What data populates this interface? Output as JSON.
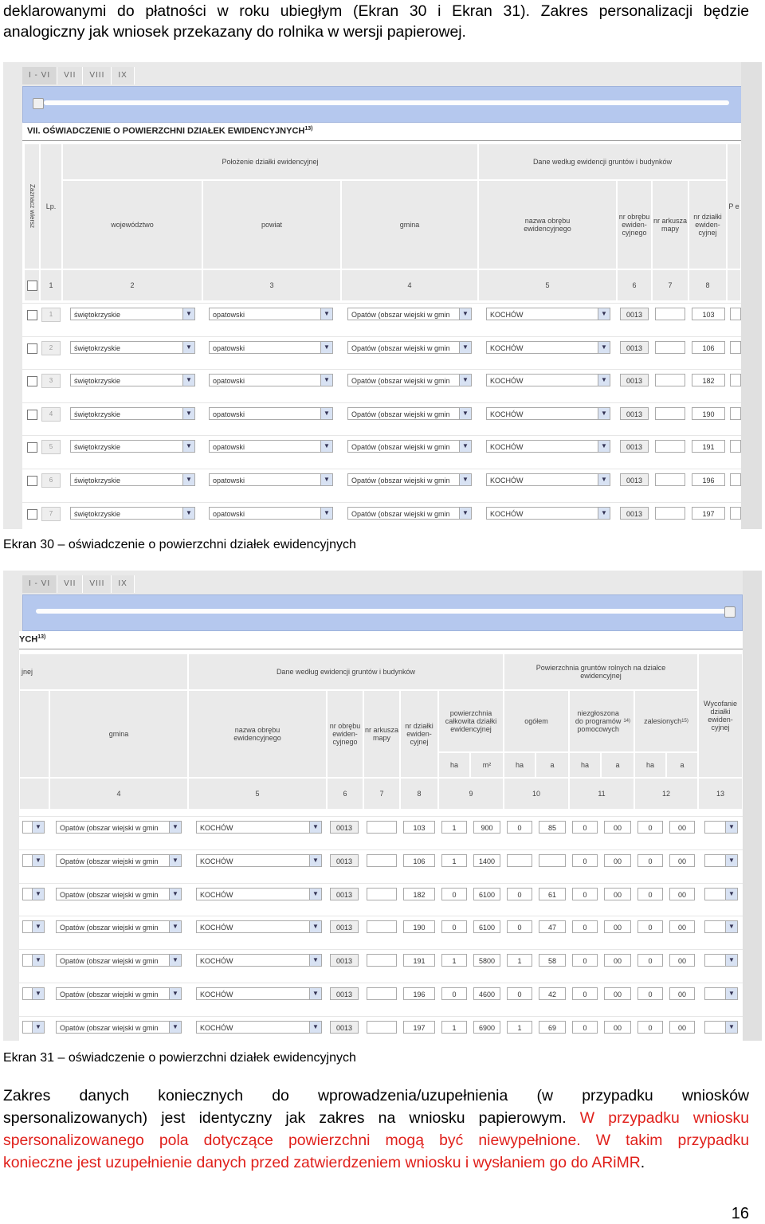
{
  "intro": {
    "line1": "deklarowanymi do płatności w roku ubiegłym (Ekran 30 i Ekran 31). Zakres personalizacji będzie",
    "line2": "analogiczny jak wniosek przekazany do rolnika w wersji papierowej."
  },
  "screen1": {
    "tabs": [
      "I - VI",
      "VII",
      "VIII",
      "IX"
    ],
    "section_title": "VII. OŚWIADCZENIE O POWIERZCHNI DZIAŁEK EWIDENCYJNYCH",
    "section_sup": "13)",
    "headers": {
      "zaznacz": "Zaznacz wiersz",
      "lp": "Lp.",
      "polozenie": "Położenie działki ewidencyjnej",
      "dane": "Dane według ewidencji gruntów i budynków",
      "wojewodztwo": "województwo",
      "powiat": "powiat",
      "gmina": "gmina",
      "obreb": "nazwa obrębu ewidencyjnego",
      "nr_obrebu": "nr obrębu ewiden-cyjnego",
      "nr_arkusza": "nr arkusza mapy",
      "nr_dzialki": "nr działki ewiden-cyjnej",
      "extra": "P e"
    },
    "colnums": [
      "1",
      "2",
      "3",
      "4",
      "5",
      "6",
      "7",
      "8"
    ]
  },
  "rows": [
    {
      "lp": "1",
      "woj": "świętokrzyskie",
      "pow": "opatowski",
      "gmina": "Opatów (obszar wiejski w gmin",
      "obreb": "KOCHÓW",
      "nr_obrebu": "0013",
      "nr_dzialki": "103",
      "ha": "1",
      "m2": "900",
      "og_ha": "0",
      "og_a": "85",
      "pp_ha": "0",
      "pp_a": "00",
      "z_ha": "0",
      "z_a": "00"
    },
    {
      "lp": "2",
      "woj": "świętokrzyskie",
      "pow": "opatowski",
      "gmina": "Opatów (obszar wiejski w gmin",
      "obreb": "KOCHÓW",
      "nr_obrebu": "0013",
      "nr_dzialki": "106",
      "ha": "1",
      "m2": "1400",
      "og_ha": "",
      "og_a": "",
      "pp_ha": "0",
      "pp_a": "00",
      "z_ha": "0",
      "z_a": "00"
    },
    {
      "lp": "3",
      "woj": "świętokrzyskie",
      "pow": "opatowski",
      "gmina": "Opatów (obszar wiejski w gmin",
      "obreb": "KOCHÓW",
      "nr_obrebu": "0013",
      "nr_dzialki": "182",
      "ha": "0",
      "m2": "6100",
      "og_ha": "0",
      "og_a": "61",
      "pp_ha": "0",
      "pp_a": "00",
      "z_ha": "0",
      "z_a": "00"
    },
    {
      "lp": "4",
      "woj": "świętokrzyskie",
      "pow": "opatowski",
      "gmina": "Opatów (obszar wiejski w gmin",
      "obreb": "KOCHÓW",
      "nr_obrebu": "0013",
      "nr_dzialki": "190",
      "ha": "0",
      "m2": "6100",
      "og_ha": "0",
      "og_a": "47",
      "pp_ha": "0",
      "pp_a": "00",
      "z_ha": "0",
      "z_a": "00"
    },
    {
      "lp": "5",
      "woj": "świętokrzyskie",
      "pow": "opatowski",
      "gmina": "Opatów (obszar wiejski w gmin",
      "obreb": "KOCHÓW",
      "nr_obrebu": "0013",
      "nr_dzialki": "191",
      "ha": "1",
      "m2": "5800",
      "og_ha": "1",
      "og_a": "58",
      "pp_ha": "0",
      "pp_a": "00",
      "z_ha": "0",
      "z_a": "00"
    },
    {
      "lp": "6",
      "woj": "świętokrzyskie",
      "pow": "opatowski",
      "gmina": "Opatów (obszar wiejski w gmin",
      "obreb": "KOCHÓW",
      "nr_obrebu": "0013",
      "nr_dzialki": "196",
      "ha": "0",
      "m2": "4600",
      "og_ha": "0",
      "og_a": "42",
      "pp_ha": "0",
      "pp_a": "00",
      "z_ha": "0",
      "z_a": "00"
    },
    {
      "lp": "7",
      "woj": "świętokrzyskie",
      "pow": "opatowski",
      "gmina": "Opatów (obszar wiejski w gmin",
      "obreb": "KOCHÓW",
      "nr_obrebu": "0013",
      "nr_dzialki": "197",
      "ha": "1",
      "m2": "6900",
      "og_ha": "1",
      "og_a": "69",
      "pp_ha": "0",
      "pp_a": "00",
      "z_ha": "0",
      "z_a": "00"
    }
  ],
  "caption1": "Ekran 30 – oświadczenie o powierzchni działek ewidencyjnych",
  "screen2": {
    "tabs": [
      "I - VI",
      "VII",
      "VIII",
      "IX"
    ],
    "section_title": "YCH",
    "section_sup": "13)",
    "headers": {
      "polozenie_tail": "jnej",
      "dane": "Dane według ewidencji gruntów i budynków",
      "pow_rolnych": "Powierzchnia gruntów rolnych na działce ewidencyjnej",
      "gmina": "gmina",
      "obreb": "nazwa obrębu ewidencyjnego",
      "nr_obrebu": "nr obrębu ewiden-cyjnego",
      "nr_arkusza": "nr arkusza mapy",
      "nr_dzialki": "nr działki ewiden-cyjnej",
      "pow_calk": "powierzchnia całkowita działki ewidencyjnej",
      "ogolem": "ogółem",
      "niezgloszona": "niezgłoszona do programów pomocowych",
      "niezgloszona_sup": "14)",
      "zalesionych": "zalesionych",
      "zalesionych_sup": "15)",
      "wycofanie": "Wycofanie działki ewiden-cyjnej",
      "ha": "ha",
      "m2": "m²",
      "a": "a"
    },
    "colnums": [
      "4",
      "5",
      "6",
      "7",
      "8",
      "9",
      "10",
      "11",
      "12",
      "13"
    ]
  },
  "caption2": "Ekran 31 – oświadczenie o powierzchni działek ewidencyjnych",
  "para": {
    "l1": "Zakres danych koniecznych do wprowadzenia/uzupełnienia (w przypadku wniosków",
    "l2a": "spersonalizowanych) jest identyczny jak zakres na wniosku papierowym. ",
    "l2b": "W przypadku wniosku",
    "l3": "spersonalizowanego pola dotyczące powierzchni mogą być niewypełnione. W takim przypadku",
    "l4a": "konieczne jest uzupełnienie danych przed zatwierdzeniem wniosku i wysłaniem go do ARiMR",
    "l4b": "."
  },
  "page_number": "16",
  "colors": {
    "accent_red": "#e0201b",
    "scrollbar_blue": "#b5c8ee"
  }
}
